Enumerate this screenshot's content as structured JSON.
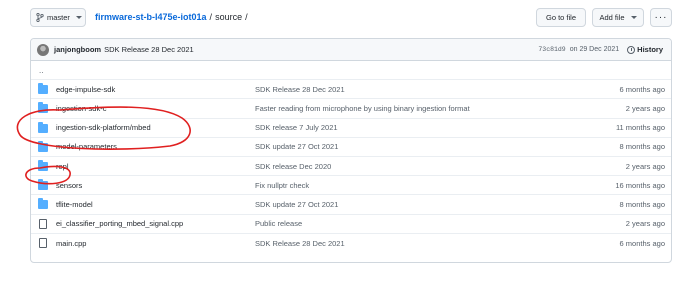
{
  "topbar": {
    "branch": "master",
    "repo": "firmware-st-b-l475e-iot01a",
    "separator": "/",
    "dir": "source",
    "trailing_sep": "/",
    "goto_file": "Go to file",
    "add_file": "Add file",
    "more": "···"
  },
  "commit": {
    "author": "janjongboom",
    "message": "SDK Release 28 Dec 2021",
    "sha": "73c81d9",
    "date": "on 29 Dec 2021",
    "history": "History"
  },
  "parent_link": "..",
  "files": [
    {
      "name": "edge-impulse-sdk",
      "type": "folder",
      "message": "SDK Release 28 Dec 2021",
      "age": "6 months ago"
    },
    {
      "name": "ingestion-sdk-c",
      "type": "folder",
      "message": "Faster reading from microphone by using binary ingestion format",
      "age": "2 years ago"
    },
    {
      "name": "ingestion-sdk-platform/mbed",
      "type": "folder",
      "message": "SDK release 7 July 2021",
      "age": "11 months ago"
    },
    {
      "name": "model-parameters",
      "type": "folder",
      "message": "SDK update 27 Oct 2021",
      "age": "8 months ago"
    },
    {
      "name": "repl",
      "type": "folder",
      "message": "SDK release Dec 2020",
      "age": "2 years ago"
    },
    {
      "name": "sensors",
      "type": "folder",
      "message": "Fix nullptr check",
      "age": "16 months ago"
    },
    {
      "name": "tflite-model",
      "type": "folder",
      "message": "SDK update 27 Oct 2021",
      "age": "8 months ago"
    },
    {
      "name": "ei_classifier_porting_mbed_signal.cpp",
      "type": "file",
      "message": "Public release",
      "age": "2 years ago"
    },
    {
      "name": "main.cpp",
      "type": "file",
      "message": "SDK Release 28 Dec 2021",
      "age": "6 months ago"
    }
  ],
  "colors": {
    "link": "#0969da",
    "folder": "#54aeff",
    "annotation": "#e02020"
  }
}
